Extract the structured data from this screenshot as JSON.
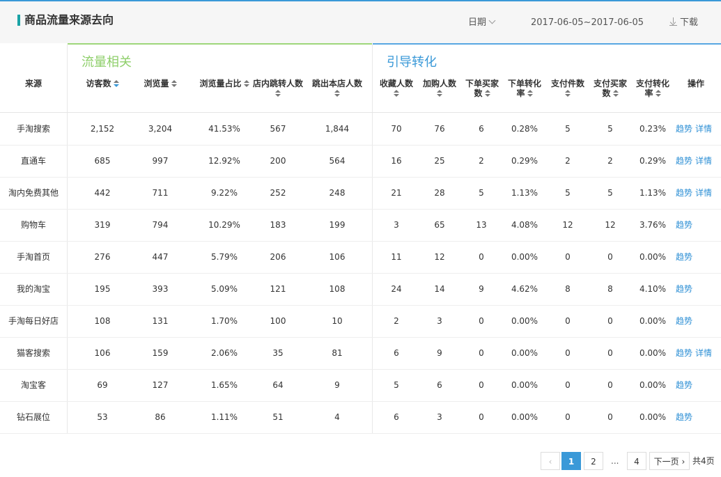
{
  "header": {
    "title": "商品流量来源去向",
    "date_label": "日期",
    "date_range": "2017-06-05~2017-06-05",
    "download_label": "下载"
  },
  "groups": {
    "traffic": "流量相关",
    "conversion": "引导转化"
  },
  "columns": {
    "source": "来源",
    "visitors": "访客数",
    "pageviews": "浏览量",
    "pv_share": "浏览量占比",
    "internal_jump": "店内跳转人数",
    "exit": "跳出本店人数",
    "favorites": "收藏人数",
    "cart_adds": "加购人数",
    "order_buyers": [
      "下单买家",
      "数"
    ],
    "order_rate": [
      "下单转化",
      "率"
    ],
    "paid_items": "支付件数",
    "paid_buyers": [
      "支付买家",
      "数"
    ],
    "paid_rate": [
      "支付转化",
      "率"
    ],
    "actions": "操作"
  },
  "actions": {
    "trend": "趋势",
    "detail": "详情"
  },
  "rows": [
    {
      "source": "手淘搜索",
      "visitors": "2,152",
      "pageviews": "3,204",
      "pv_share": "41.53%",
      "internal_jump": "567",
      "exit": "1,844",
      "favorites": "70",
      "cart_adds": "76",
      "order_buyers": "6",
      "order_rate": "0.28%",
      "paid_items": "5",
      "paid_buyers": "5",
      "paid_rate": "0.23%",
      "has_detail": true
    },
    {
      "source": "直通车",
      "visitors": "685",
      "pageviews": "997",
      "pv_share": "12.92%",
      "internal_jump": "200",
      "exit": "564",
      "favorites": "16",
      "cart_adds": "25",
      "order_buyers": "2",
      "order_rate": "0.29%",
      "paid_items": "2",
      "paid_buyers": "2",
      "paid_rate": "0.29%",
      "has_detail": true
    },
    {
      "source": "淘内免费其他",
      "visitors": "442",
      "pageviews": "711",
      "pv_share": "9.22%",
      "internal_jump": "252",
      "exit": "248",
      "favorites": "21",
      "cart_adds": "28",
      "order_buyers": "5",
      "order_rate": "1.13%",
      "paid_items": "5",
      "paid_buyers": "5",
      "paid_rate": "1.13%",
      "has_detail": true
    },
    {
      "source": "购物车",
      "visitors": "319",
      "pageviews": "794",
      "pv_share": "10.29%",
      "internal_jump": "183",
      "exit": "199",
      "favorites": "3",
      "cart_adds": "65",
      "order_buyers": "13",
      "order_rate": "4.08%",
      "paid_items": "12",
      "paid_buyers": "12",
      "paid_rate": "3.76%",
      "has_detail": false
    },
    {
      "source": "手淘首页",
      "visitors": "276",
      "pageviews": "447",
      "pv_share": "5.79%",
      "internal_jump": "206",
      "exit": "106",
      "favorites": "11",
      "cart_adds": "12",
      "order_buyers": "0",
      "order_rate": "0.00%",
      "paid_items": "0",
      "paid_buyers": "0",
      "paid_rate": "0.00%",
      "has_detail": false
    },
    {
      "source": "我的淘宝",
      "visitors": "195",
      "pageviews": "393",
      "pv_share": "5.09%",
      "internal_jump": "121",
      "exit": "108",
      "favorites": "24",
      "cart_adds": "14",
      "order_buyers": "9",
      "order_rate": "4.62%",
      "paid_items": "8",
      "paid_buyers": "8",
      "paid_rate": "4.10%",
      "has_detail": false
    },
    {
      "source": "手淘每日好店",
      "visitors": "108",
      "pageviews": "131",
      "pv_share": "1.70%",
      "internal_jump": "100",
      "exit": "10",
      "favorites": "2",
      "cart_adds": "3",
      "order_buyers": "0",
      "order_rate": "0.00%",
      "paid_items": "0",
      "paid_buyers": "0",
      "paid_rate": "0.00%",
      "has_detail": false
    },
    {
      "source": "猫客搜索",
      "visitors": "106",
      "pageviews": "159",
      "pv_share": "2.06%",
      "internal_jump": "35",
      "exit": "81",
      "favorites": "6",
      "cart_adds": "9",
      "order_buyers": "0",
      "order_rate": "0.00%",
      "paid_items": "0",
      "paid_buyers": "0",
      "paid_rate": "0.00%",
      "has_detail": true
    },
    {
      "source": "淘宝客",
      "visitors": "69",
      "pageviews": "127",
      "pv_share": "1.65%",
      "internal_jump": "64",
      "exit": "9",
      "favorites": "5",
      "cart_adds": "6",
      "order_buyers": "0",
      "order_rate": "0.00%",
      "paid_items": "0",
      "paid_buyers": "0",
      "paid_rate": "0.00%",
      "has_detail": false
    },
    {
      "source": "钻石展位",
      "visitors": "53",
      "pageviews": "86",
      "pv_share": "1.11%",
      "internal_jump": "51",
      "exit": "4",
      "favorites": "6",
      "cart_adds": "3",
      "order_buyers": "0",
      "order_rate": "0.00%",
      "paid_items": "0",
      "paid_buyers": "0",
      "paid_rate": "0.00%",
      "has_detail": false
    }
  ],
  "pagination": {
    "pages": [
      "1",
      "2",
      "4"
    ],
    "current": "1",
    "ellipsis": "...",
    "next_label": "下一页",
    "total_label": "共4页"
  }
}
